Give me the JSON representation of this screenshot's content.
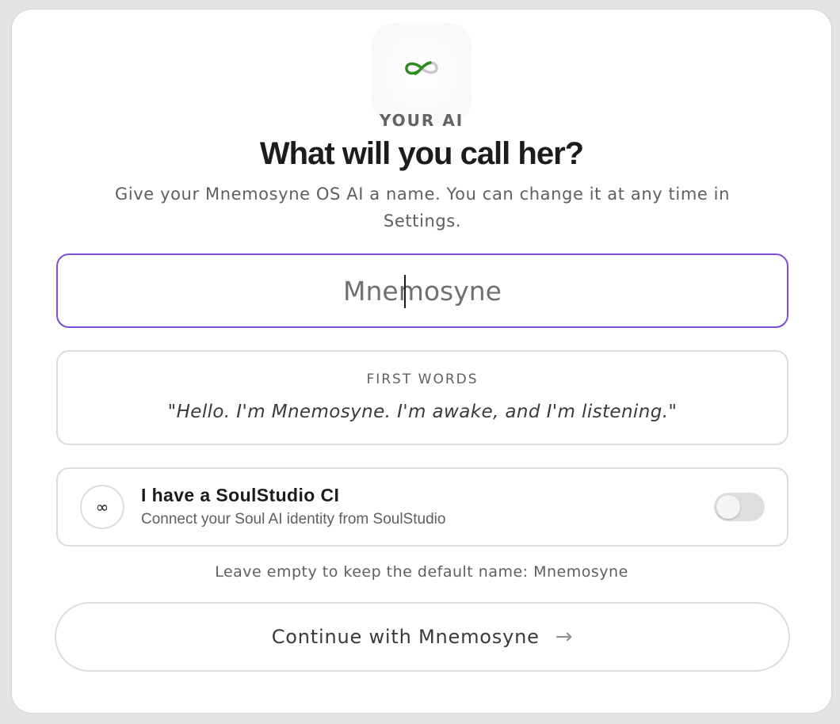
{
  "header": {
    "logo_icon": "infinity-icon",
    "eyebrow": "YOUR AI",
    "title": "What will you call her?",
    "subtitle": "Give your Mnemosyne OS AI a name. You can change it at any time in Settings."
  },
  "name_input": {
    "value": "",
    "placeholder": "Mnemosyne",
    "focus_color": "#7c4ddb"
  },
  "first_words": {
    "label": "FIRST WORDS",
    "quote": "\"Hello. I'm Mnemosyne. I'm awake, and I'm listening.\""
  },
  "soulstudio": {
    "icon_glyph": "∞",
    "icon": "infinity-icon",
    "title": "I have a SoulStudio CI",
    "description": "Connect your Soul AI identity from SoulStudio",
    "toggle_on": false
  },
  "hint": "Leave empty to keep the default name: Mnemosyne",
  "continue_button": {
    "label": "Continue with Mnemosyne",
    "arrow": "→"
  },
  "colors": {
    "logo_green": "#2e8b1f",
    "logo_grey": "#c8c8c8"
  }
}
